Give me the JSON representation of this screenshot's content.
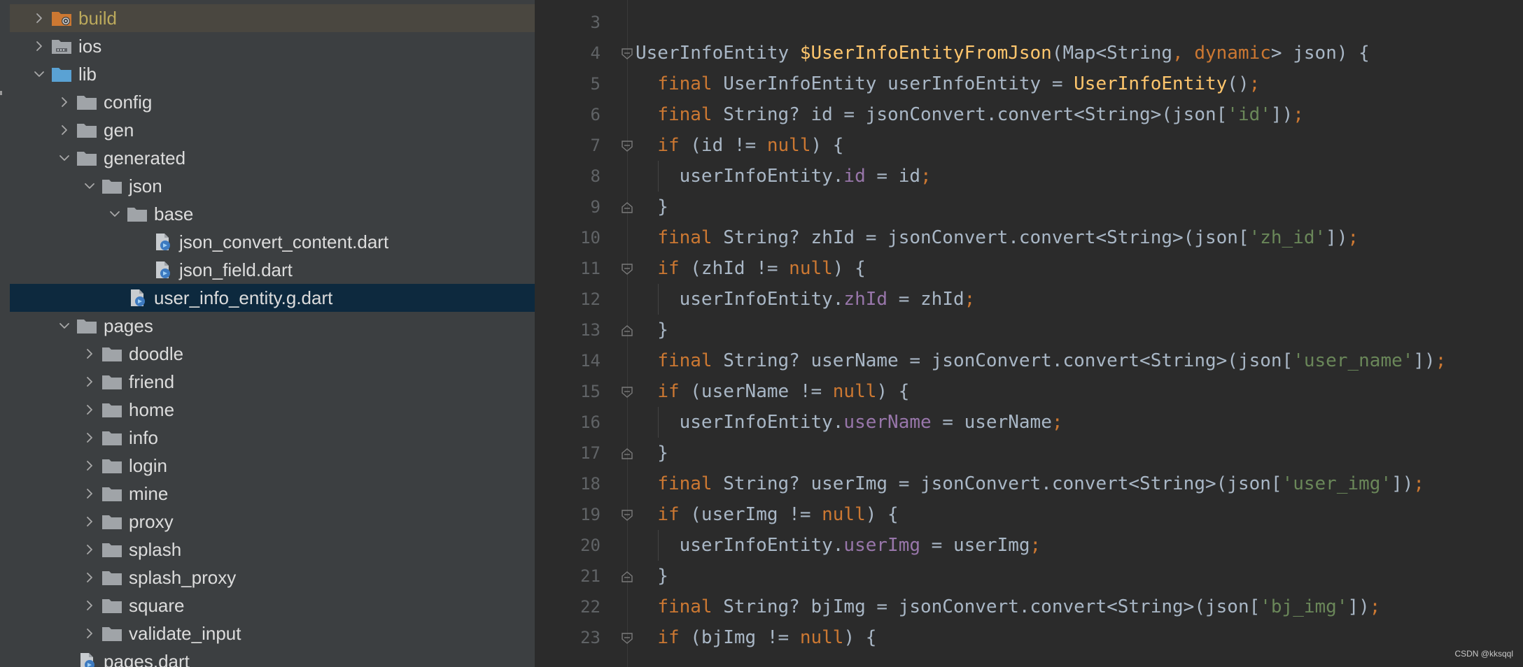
{
  "colors": {
    "panel_bg": "#3c3f41",
    "editor_bg": "#2b2b2b",
    "selection": "#0d293e",
    "build_highlight": "#4a4740",
    "keyword": "#cc7832",
    "function": "#ffc66d",
    "string": "#6a8759",
    "property": "#9876aa",
    "line_number": "#606366"
  },
  "tree": {
    "items": [
      {
        "label": "build",
        "type": "folder-build-icon",
        "expanded": false
      },
      {
        "label": "ios",
        "type": "folder-ios-icon",
        "expanded": false
      },
      {
        "label": "lib",
        "type": "folder-source-icon",
        "expanded": true
      },
      {
        "label": "config",
        "type": "folder-icon",
        "expanded": false
      },
      {
        "label": "gen",
        "type": "folder-icon",
        "expanded": false
      },
      {
        "label": "generated",
        "type": "folder-icon",
        "expanded": true
      },
      {
        "label": "json",
        "type": "folder-icon",
        "expanded": true
      },
      {
        "label": "base",
        "type": "folder-icon",
        "expanded": true
      },
      {
        "label": "json_convert_content.dart",
        "type": "dart-file-icon"
      },
      {
        "label": "json_field.dart",
        "type": "dart-file-icon"
      },
      {
        "label": "user_info_entity.g.dart",
        "type": "dart-file-icon",
        "selected": true
      },
      {
        "label": "pages",
        "type": "folder-icon",
        "expanded": true
      },
      {
        "label": "doodle",
        "type": "folder-icon",
        "expanded": false
      },
      {
        "label": "friend",
        "type": "folder-icon",
        "expanded": false
      },
      {
        "label": "home",
        "type": "folder-icon",
        "expanded": false
      },
      {
        "label": "info",
        "type": "folder-icon",
        "expanded": false
      },
      {
        "label": "login",
        "type": "folder-icon",
        "expanded": false
      },
      {
        "label": "mine",
        "type": "folder-icon",
        "expanded": false
      },
      {
        "label": "proxy",
        "type": "folder-icon",
        "expanded": false
      },
      {
        "label": "splash",
        "type": "folder-icon",
        "expanded": false
      },
      {
        "label": "splash_proxy",
        "type": "folder-icon",
        "expanded": false
      },
      {
        "label": "square",
        "type": "folder-icon",
        "expanded": false
      },
      {
        "label": "validate_input",
        "type": "folder-icon",
        "expanded": false
      },
      {
        "label": "pages.dart",
        "type": "dart-file-icon"
      }
    ]
  },
  "editor": {
    "lines": [
      {
        "num": "3",
        "tokens": []
      },
      {
        "num": "4",
        "fold": "open",
        "tokens": [
          [
            "t",
            "UserInfoEntity "
          ],
          [
            "f",
            "$UserInfoEntityFromJson"
          ],
          [
            "t",
            "(Map<String"
          ],
          [
            "k",
            ", "
          ],
          [
            "k",
            "dynamic"
          ],
          [
            "t",
            "> json) {"
          ]
        ]
      },
      {
        "num": "5",
        "tokens": [
          [
            "t",
            "  "
          ],
          [
            "k",
            "final "
          ],
          [
            "t",
            "UserInfoEntity userInfoEntity = "
          ],
          [
            "f",
            "UserInfoEntity"
          ],
          [
            "t",
            "()"
          ],
          [
            "k",
            ";"
          ]
        ]
      },
      {
        "num": "6",
        "tokens": [
          [
            "t",
            "  "
          ],
          [
            "k",
            "final "
          ],
          [
            "t",
            "String? id = jsonConvert.convert<String>(json["
          ],
          [
            "s",
            "'id'"
          ],
          [
            "t",
            "])"
          ],
          [
            "k",
            ";"
          ]
        ]
      },
      {
        "num": "7",
        "fold": "open",
        "tokens": [
          [
            "t",
            "  "
          ],
          [
            "k",
            "if "
          ],
          [
            "t",
            "(id != "
          ],
          [
            "k",
            "null"
          ],
          [
            "t",
            ") {"
          ]
        ]
      },
      {
        "num": "8",
        "tokens": [
          [
            "t",
            "    userInfoEntity."
          ],
          [
            "p",
            "id"
          ],
          [
            "t",
            " = id"
          ],
          [
            "k",
            ";"
          ]
        ]
      },
      {
        "num": "9",
        "fold": "close",
        "tokens": [
          [
            "t",
            "  }"
          ]
        ]
      },
      {
        "num": "10",
        "tokens": [
          [
            "t",
            "  "
          ],
          [
            "k",
            "final "
          ],
          [
            "t",
            "String? zhId = jsonConvert.convert<String>(json["
          ],
          [
            "s",
            "'zh_id'"
          ],
          [
            "t",
            "])"
          ],
          [
            "k",
            ";"
          ]
        ]
      },
      {
        "num": "11",
        "fold": "open",
        "tokens": [
          [
            "t",
            "  "
          ],
          [
            "k",
            "if "
          ],
          [
            "t",
            "(zhId != "
          ],
          [
            "k",
            "null"
          ],
          [
            "t",
            ") {"
          ]
        ]
      },
      {
        "num": "12",
        "tokens": [
          [
            "t",
            "    userInfoEntity."
          ],
          [
            "p",
            "zhId"
          ],
          [
            "t",
            " = zhId"
          ],
          [
            "k",
            ";"
          ]
        ]
      },
      {
        "num": "13",
        "fold": "close",
        "tokens": [
          [
            "t",
            "  }"
          ]
        ]
      },
      {
        "num": "14",
        "tokens": [
          [
            "t",
            "  "
          ],
          [
            "k",
            "final "
          ],
          [
            "t",
            "String? userName = jsonConvert.convert<String>(json["
          ],
          [
            "s",
            "'user_name'"
          ],
          [
            "t",
            "])"
          ],
          [
            "k",
            ";"
          ]
        ]
      },
      {
        "num": "15",
        "fold": "open",
        "tokens": [
          [
            "t",
            "  "
          ],
          [
            "k",
            "if "
          ],
          [
            "t",
            "(userName != "
          ],
          [
            "k",
            "null"
          ],
          [
            "t",
            ") {"
          ]
        ]
      },
      {
        "num": "16",
        "tokens": [
          [
            "t",
            "    userInfoEntity."
          ],
          [
            "p",
            "userName"
          ],
          [
            "t",
            " = userName"
          ],
          [
            "k",
            ";"
          ]
        ]
      },
      {
        "num": "17",
        "fold": "close",
        "tokens": [
          [
            "t",
            "  }"
          ]
        ]
      },
      {
        "num": "18",
        "tokens": [
          [
            "t",
            "  "
          ],
          [
            "k",
            "final "
          ],
          [
            "t",
            "String? userImg = jsonConvert.convert<String>(json["
          ],
          [
            "s",
            "'user_img'"
          ],
          [
            "t",
            "])"
          ],
          [
            "k",
            ";"
          ]
        ]
      },
      {
        "num": "19",
        "fold": "open",
        "tokens": [
          [
            "t",
            "  "
          ],
          [
            "k",
            "if "
          ],
          [
            "t",
            "(userImg != "
          ],
          [
            "k",
            "null"
          ],
          [
            "t",
            ") {"
          ]
        ]
      },
      {
        "num": "20",
        "tokens": [
          [
            "t",
            "    userInfoEntity."
          ],
          [
            "p",
            "userImg"
          ],
          [
            "t",
            " = userImg"
          ],
          [
            "k",
            ";"
          ]
        ]
      },
      {
        "num": "21",
        "fold": "close",
        "tokens": [
          [
            "t",
            "  }"
          ]
        ]
      },
      {
        "num": "22",
        "tokens": [
          [
            "t",
            "  "
          ],
          [
            "k",
            "final "
          ],
          [
            "t",
            "String? bjImg = jsonConvert.convert<String>(json["
          ],
          [
            "s",
            "'bj_img'"
          ],
          [
            "t",
            "])"
          ],
          [
            "k",
            ";"
          ]
        ]
      },
      {
        "num": "23",
        "fold": "open",
        "tokens": [
          [
            "t",
            "  "
          ],
          [
            "k",
            "if "
          ],
          [
            "t",
            "(bjImg != "
          ],
          [
            "k",
            "null"
          ],
          [
            "t",
            ") {"
          ]
        ]
      }
    ]
  },
  "watermark": "CSDN @kksqql"
}
